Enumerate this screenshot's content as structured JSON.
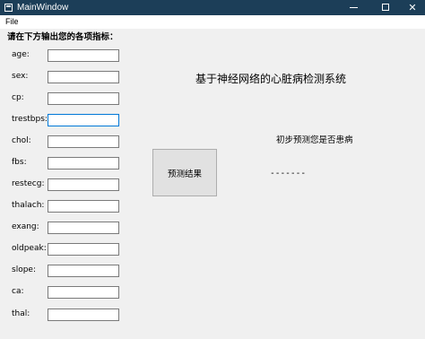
{
  "window": {
    "title": "MainWindow",
    "controls": {
      "minimize": "minimize",
      "maximize": "maximize",
      "close": "✕"
    }
  },
  "menu": {
    "file": "File"
  },
  "form": {
    "header": "请在下方输出您的各项指标：",
    "fields": [
      {
        "label": "age:",
        "value": ""
      },
      {
        "label": "sex:",
        "value": ""
      },
      {
        "label": "cp:",
        "value": ""
      },
      {
        "label": "trestbps:",
        "value": ""
      },
      {
        "label": "chol:",
        "value": ""
      },
      {
        "label": "fbs:",
        "value": ""
      },
      {
        "label": "restecg:",
        "value": ""
      },
      {
        "label": "thalach:",
        "value": ""
      },
      {
        "label": "exang:",
        "value": ""
      },
      {
        "label": "oldpeak:",
        "value": ""
      },
      {
        "label": "slope:",
        "value": ""
      },
      {
        "label": "ca:",
        "value": ""
      },
      {
        "label": "thal:",
        "value": ""
      }
    ]
  },
  "app_title": "基于神经网络的心脏病检测系统",
  "predict_button": "预测结果",
  "result": {
    "caption": "初步预测您是否患病",
    "value": "-------"
  }
}
